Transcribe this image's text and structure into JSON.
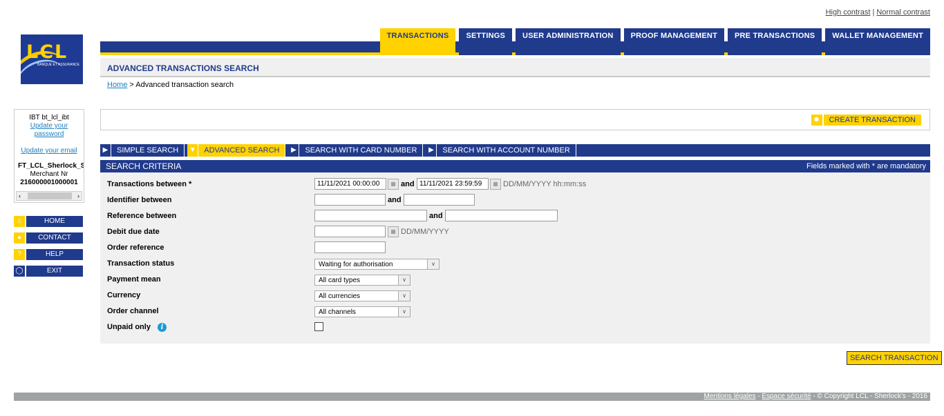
{
  "contrast": {
    "high": "High contrast",
    "sep": "|",
    "normal": "Normal contrast"
  },
  "logo": {
    "text": "LCL",
    "tagline": "BANQUE ET ASSURANCE"
  },
  "tabs": [
    "TRANSACTIONS",
    "SETTINGS",
    "USER ADMINISTRATION",
    "PROOF MANAGEMENT",
    "PRE TRANSACTIONS",
    "WALLET MANAGEMENT"
  ],
  "page_title": "ADVANCED TRANSACTIONS SEARCH",
  "breadcrumb": {
    "home": "Home",
    "sep": " > ",
    "current": "Advanced transaction search"
  },
  "user": {
    "name": "IBT bt_lcl_ibt",
    "update_password": "Update your password",
    "update_email": "Update your email",
    "merchant_name": "FT_LCL_Sherlock_S",
    "merchant_label": "Merchant Nr",
    "merchant_nr": "216000001000001"
  },
  "sidenav": [
    "HOME",
    "CONTACT",
    "HELP",
    "EXIT"
  ],
  "create_transaction": "CREATE TRANSACTION",
  "search_tabs": [
    "SIMPLE SEARCH",
    "ADVANCED SEARCH",
    "SEARCH WITH CARD NUMBER",
    "SEARCH WITH ACCOUNT NUMBER"
  ],
  "criteria": {
    "title": "SEARCH CRITERIA",
    "mandatory_note": "Fields marked with * are mandatory",
    "and": "and",
    "transactions_between": {
      "label": "Transactions between *",
      "from": "11/11/2021 00:00:00",
      "to": "11/11/2021 23:59:59",
      "format": "DD/MM/YYYY hh:mm:ss"
    },
    "identifier_between": {
      "label": "Identifier between",
      "from": "",
      "to": ""
    },
    "reference_between": {
      "label": "Reference between",
      "from": "",
      "to": ""
    },
    "debit_due_date": {
      "label": "Debit due date",
      "value": "",
      "format": "DD/MM/YYYY"
    },
    "order_reference": {
      "label": "Order reference",
      "value": ""
    },
    "transaction_status": {
      "label": "Transaction status",
      "value": "Waiting for authorisation"
    },
    "payment_mean": {
      "label": "Payment mean",
      "value": "All card types"
    },
    "currency": {
      "label": "Currency",
      "value": "All currencies"
    },
    "order_channel": {
      "label": "Order channel",
      "value": "All channels"
    },
    "unpaid_only": {
      "label": "Unpaid only"
    }
  },
  "search_button": "SEARCH TRANSACTION",
  "footer": {
    "mentions": "Mentions légales",
    "security": "Espace sécurité",
    "copyright": "© Copyright LCL - Sherlock's - 2016"
  }
}
